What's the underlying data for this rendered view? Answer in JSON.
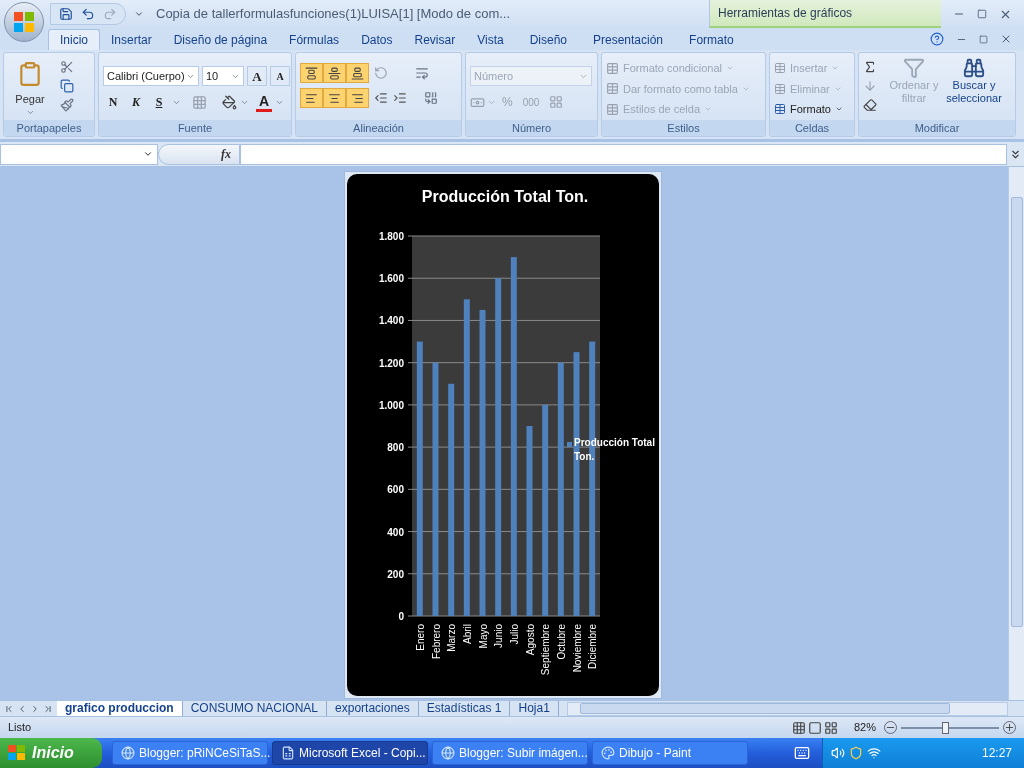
{
  "title_bar": {
    "title": "Copia de tallerformulasfunciones(1)LUISA[1]  [Modo de com...",
    "context_label": "Herramientas de gráficos"
  },
  "tabs": [
    {
      "label": "Inicio",
      "selected": true,
      "kind": "normal"
    },
    {
      "label": "Insertar",
      "selected": false,
      "kind": "normal"
    },
    {
      "label": "Diseño de página",
      "selected": false,
      "kind": "normal"
    },
    {
      "label": "Fórmulas",
      "selected": false,
      "kind": "normal"
    },
    {
      "label": "Datos",
      "selected": false,
      "kind": "normal"
    },
    {
      "label": "Revisar",
      "selected": false,
      "kind": "normal"
    },
    {
      "label": "Vista",
      "selected": false,
      "kind": "normal"
    },
    {
      "label": "Diseño",
      "selected": false,
      "kind": "contextual"
    },
    {
      "label": "Presentación",
      "selected": false,
      "kind": "contextual"
    },
    {
      "label": "Formato",
      "selected": false,
      "kind": "contextual"
    }
  ],
  "ribbon": {
    "clipboard": {
      "label": "Portapapeles",
      "paste": "Pegar"
    },
    "font": {
      "label": "Fuente",
      "font_name": "Calibri (Cuerpo)",
      "font_size": "10",
      "grow": "A",
      "shrink": "A",
      "bold": "N",
      "italic": "K",
      "underline": "S",
      "font_color": "A"
    },
    "alignment": {
      "label": "Alineación",
      "buttons": [
        {
          "kind": "top",
          "selected": true
        },
        {
          "kind": "middle",
          "selected": true
        },
        {
          "kind": "bottom",
          "selected": true
        },
        {
          "kind": "left",
          "selected": true
        },
        {
          "kind": "center",
          "selected": true
        },
        {
          "kind": "right",
          "selected": true
        }
      ]
    },
    "number": {
      "label": "Número",
      "format": "Número",
      "disabled": true,
      "percent": "%",
      "thousands": "000"
    },
    "styles": {
      "label": "Estilos",
      "items": [
        {
          "label": "Formato condicional",
          "disabled": true
        },
        {
          "label": "Dar formato como tabla",
          "disabled": true
        },
        {
          "label": "Estilos de celda",
          "disabled": true
        }
      ]
    },
    "cells": {
      "label": "Celdas",
      "items": [
        {
          "label": "Insertar",
          "disabled": true
        },
        {
          "label": "Eliminar",
          "disabled": true
        },
        {
          "label": "Formato",
          "disabled": false
        }
      ]
    },
    "editing": {
      "label": "Modificar",
      "sort": {
        "label": "Ordenar y filtrar",
        "disabled": true
      },
      "find": {
        "label": "Buscar y seleccionar",
        "disabled": false
      }
    }
  },
  "formula_bar": {
    "function_label": "fx"
  },
  "chart": {
    "chart_data": {
      "type": "bar",
      "grid": true,
      "title": "Producción Total Ton.",
      "categories": [
        "Enero",
        "Febrero",
        "Marzo",
        "Abril",
        "Mayo",
        "Junio",
        "Julio",
        "Agosto",
        "Septiembre",
        "Octubre",
        "Noviembre",
        "Diciembre"
      ],
      "series": [
        {
          "name": "Producción Total Ton.",
          "color": "#4f81bd",
          "values": [
            1300,
            1200,
            1100,
            1500,
            1450,
            1600,
            1700,
            900,
            1000,
            1200,
            1250,
            1300
          ]
        }
      ],
      "ylim": [
        0,
        1800
      ],
      "yticks": [
        {
          "value": 0,
          "label": "0"
        },
        {
          "value": 200,
          "label": "200"
        },
        {
          "value": 400,
          "label": "400"
        },
        {
          "value": 600,
          "label": "600"
        },
        {
          "value": 800,
          "label": "800"
        },
        {
          "value": 1000,
          "label": "1.000"
        },
        {
          "value": 1200,
          "label": "1.200"
        },
        {
          "value": 1400,
          "label": "1.400"
        },
        {
          "value": 1600,
          "label": "1.600"
        },
        {
          "value": 1800,
          "label": "1.800"
        }
      ]
    }
  },
  "sheet_tabs": [
    {
      "label": "grafico produccion",
      "selected": true
    },
    {
      "label": "CONSUMO NACIONAL",
      "selected": false
    },
    {
      "label": "exportaciones",
      "selected": false
    },
    {
      "label": "Estadísticas 1",
      "selected": false
    },
    {
      "label": "Hoja1",
      "selected": false
    }
  ],
  "status_bar": {
    "text": "Listo",
    "zoom": "82%",
    "zoom_slider": {
      "level": 0.45
    }
  },
  "taskbar": {
    "start": "Inicio",
    "items": [
      {
        "label": "Blogger: pRiNCeSiTaS...",
        "kind": "browser",
        "selected": false
      },
      {
        "label": "Microsoft Excel - Copi...",
        "kind": "spreadsheet",
        "selected": true
      },
      {
        "label": "Blogger: Subir imágen...",
        "kind": "browser",
        "selected": false
      },
      {
        "label": "Dibujo - Paint",
        "kind": "paint",
        "selected": false
      }
    ],
    "clock": "12:27"
  }
}
